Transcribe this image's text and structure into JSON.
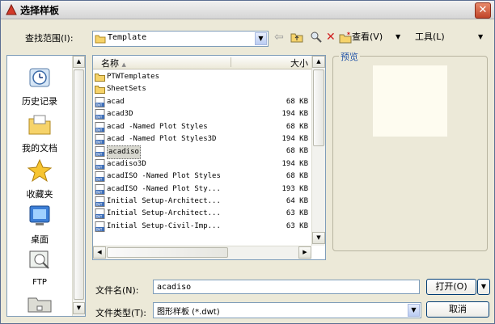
{
  "window": {
    "title": "选择样板"
  },
  "toolbar": {
    "lookin_label": "查找范围(I):",
    "lookin_value": "Template",
    "view_label": "查看(V)",
    "tools_label": "工具(L)"
  },
  "places": [
    {
      "label": "历史记录",
      "icon": "history-icon"
    },
    {
      "label": "我的文档",
      "icon": "my-documents-icon"
    },
    {
      "label": "收藏夹",
      "icon": "favorites-icon"
    },
    {
      "label": "桌面",
      "icon": "desktop-icon"
    },
    {
      "label": "FTP",
      "icon": "ftp-icon"
    }
  ],
  "filelist": {
    "col_name": "名称",
    "col_size": "大小",
    "rows": [
      {
        "name": "PTWTemplates",
        "size": "",
        "type": "folder"
      },
      {
        "name": "SheetSets",
        "size": "",
        "type": "folder"
      },
      {
        "name": "acad",
        "size": "68 KB",
        "type": "dwt"
      },
      {
        "name": "acad3D",
        "size": "194 KB",
        "type": "dwt"
      },
      {
        "name": "acad -Named Plot Styles",
        "size": "68 KB",
        "type": "dwt"
      },
      {
        "name": "acad -Named Plot Styles3D",
        "size": "194 KB",
        "type": "dwt"
      },
      {
        "name": "acadiso",
        "size": "68 KB",
        "type": "dwt",
        "selected": true
      },
      {
        "name": "acadiso3D",
        "size": "194 KB",
        "type": "dwt"
      },
      {
        "name": "acadISO -Named Plot Styles",
        "size": "68 KB",
        "type": "dwt"
      },
      {
        "name": "acadISO -Named Plot Sty...",
        "size": "193 KB",
        "type": "dwt"
      },
      {
        "name": "Initial Setup-Architect...",
        "size": "64 KB",
        "type": "dwt"
      },
      {
        "name": "Initial Setup-Architect...",
        "size": "63 KB",
        "type": "dwt"
      },
      {
        "name": "Initial Setup-Civil-Imp...",
        "size": "63 KB",
        "type": "dwt"
      }
    ]
  },
  "preview": {
    "label": "预览"
  },
  "filename": {
    "label": "文件名(N):",
    "value": "acadiso"
  },
  "filetype": {
    "label": "文件类型(T):",
    "value": "图形样板 (*.dwt)"
  },
  "buttons": {
    "open": "打开(O)",
    "cancel": "取消"
  },
  "colors": {
    "accent": "#2455a8",
    "dwt_icon": "#3f6fb8",
    "folder": "#f6d36a"
  }
}
